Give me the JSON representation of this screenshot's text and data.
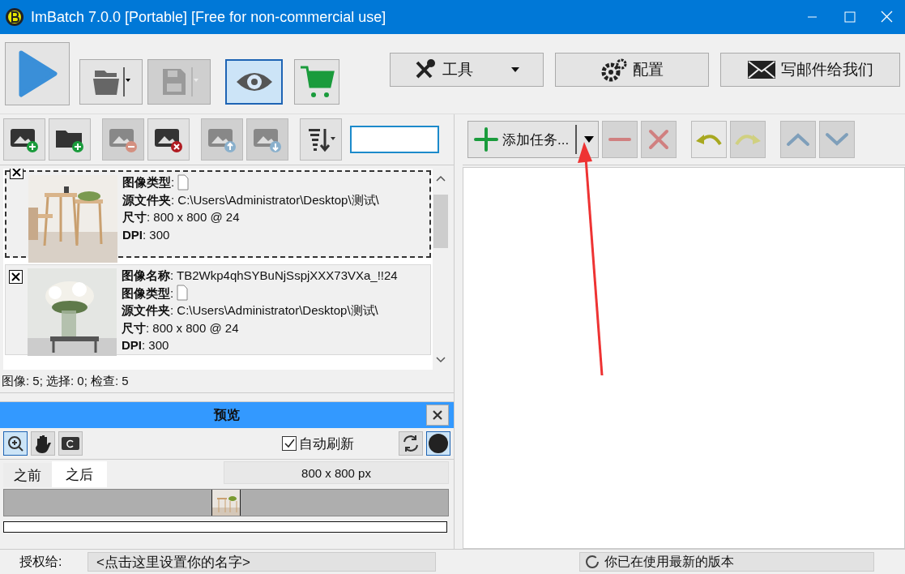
{
  "window": {
    "title": "ImBatch 7.0.0 [Portable] [Free for non-commercial use]"
  },
  "main_toolbar": {
    "buttons": [
      {
        "kind": "play",
        "disabled": false,
        "selected": false
      },
      {
        "kind": "open",
        "disabled": false,
        "selected": false
      },
      {
        "kind": "save",
        "disabled": true,
        "selected": false
      },
      {
        "kind": "preview",
        "disabled": false,
        "selected": true
      },
      {
        "kind": "cart",
        "disabled": false,
        "selected": false
      }
    ],
    "menus": [
      {
        "kind": "tools",
        "label": "工具",
        "dropdown": true
      },
      {
        "kind": "config",
        "label": "配置",
        "dropdown": false
      },
      {
        "kind": "mail",
        "label": "写邮件给我们",
        "dropdown": false
      }
    ]
  },
  "image_toolbar": {
    "buttons": [
      {
        "kind": "add-image",
        "disabled": false
      },
      {
        "kind": "add-folder",
        "disabled": false
      },
      {
        "kind": "remove",
        "disabled": true
      },
      {
        "kind": "clear",
        "disabled": false
      },
      {
        "kind": "up",
        "disabled": true
      },
      {
        "kind": "down",
        "disabled": true
      },
      {
        "kind": "sort",
        "disabled": false
      }
    ],
    "search": {
      "focused": true
    }
  },
  "images": [
    {
      "checked": true,
      "focused": true,
      "fields": [
        {
          "kind": "file",
          "text": "**图像类型**:"
        },
        {
          "kind": "text",
          "text": "**源文件夹**: C:\\Users\\Administrator\\Desktop\\测试\\"
        },
        {
          "kind": "text",
          "text": "**尺寸**: 800 x 800 @ 24"
        },
        {
          "kind": "text",
          "text": "**DPI**: 300"
        }
      ]
    },
    {
      "checked": true,
      "focused": false,
      "fields": [
        {
          "kind": "text",
          "text": "**图像名称**: TB2Wkp4qhSYBuNjSspjXXX73VXa_!!24"
        },
        {
          "kind": "file",
          "text": "**图像类型**:"
        },
        {
          "kind": "text",
          "text": "**源文件夹**: C:\\Users\\Administrator\\Desktop\\测试\\"
        },
        {
          "kind": "text",
          "text": "**尺寸**: 800 x 800 @ 24"
        },
        {
          "kind": "text",
          "text": "**DPI**: 300"
        }
      ]
    }
  ],
  "image_status": "图像: 5; 选择: 0; 检查: 5",
  "preview": {
    "title": "预览",
    "tools": [
      {
        "kind": "zoom-fit",
        "selected": true
      },
      {
        "kind": "hand",
        "selected": false
      },
      {
        "kind": "rotate",
        "selected": false
      }
    ],
    "auto_refresh": {
      "label": "自动刷新",
      "checked": true
    },
    "right_tools": [
      {
        "kind": "refresh",
        "selected": false
      },
      {
        "kind": "circle",
        "selected": true
      }
    ],
    "tabs": [
      {
        "label": "之前",
        "selected": false
      },
      {
        "label": "之后",
        "selected": true
      }
    ],
    "size": "800 x 800 px",
    "progress": {
      "level": 0
    }
  },
  "task_toolbar": {
    "add": {
      "label": "添加任务..."
    },
    "buttons": [
      {
        "kind": "minus",
        "disabled": true
      },
      {
        "kind": "delete",
        "disabled": true
      },
      {
        "kind": "undo",
        "disabled": false
      },
      {
        "kind": "redo",
        "disabled": true
      },
      {
        "kind": "up",
        "disabled": true
      },
      {
        "kind": "down",
        "disabled": true
      }
    ]
  },
  "status_bar": {
    "license_label": "授权给:",
    "license_value": "<点击这里设置你的名字>",
    "update": "你已在使用最新的版本"
  }
}
